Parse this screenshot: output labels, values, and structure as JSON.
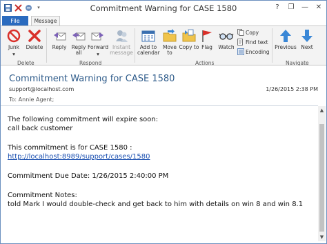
{
  "window": {
    "title": "Commitment Warning for CASE 1580",
    "controls": {
      "help": "?",
      "restore": "❐",
      "minimize": "—",
      "close": "✕"
    }
  },
  "tabs": {
    "file": "File",
    "message": "Message"
  },
  "ribbon": {
    "delete_group": {
      "label": "Delete",
      "junk": "Junk",
      "junk_arrow": "▾",
      "delete": "Delete"
    },
    "respond_group": {
      "label": "Respond",
      "reply": "Reply",
      "reply_all": "Reply all",
      "forward": "Forward",
      "forward_arrow": "▾",
      "instant_message": "Instant message"
    },
    "actions_group": {
      "label": "Actions",
      "add_to_calendar": "Add to calendar",
      "move_to": "Move to",
      "copy_to": "Copy to",
      "flag": "Flag",
      "watch": "Watch",
      "copy": "Copy",
      "find_text": "Find text",
      "encoding": "Encoding"
    },
    "navigate_group": {
      "label": "Navigate",
      "previous": "Previous",
      "next": "Next"
    }
  },
  "message": {
    "subject": "Commitment Warning for CASE 1580",
    "sender": "support@localhost.com",
    "date": "1/26/2015 2:38 PM",
    "to_label": "To:",
    "to_value": "Annie Agent;",
    "body": {
      "line1": "The following commitment will expire soon:",
      "line2": "call back customer",
      "line3": "This commitment is for CASE 1580 :",
      "link": "http://localhost:8989/support/cases/1580",
      "line4": "Commitment Due Date: 1/26/2015 2:40:00 PM",
      "line5": "Commitment Notes:",
      "line6": "told Mark I would double-check and get back to him with details on win 8 and win 8.1"
    }
  },
  "colors": {
    "accent": "#2a6bbf",
    "subject": "#2e5b8a",
    "link": "#1a4fb0",
    "flag_red": "#d9302a",
    "arrow_blue": "#3a87d6"
  },
  "icons": {
    "save": "save-icon",
    "close_small": "close-icon",
    "undo": "undo-icon",
    "junk": "junk-icon",
    "delete": "delete-icon",
    "reply": "reply-icon",
    "reply_all": "reply-all-icon",
    "forward": "forward-icon",
    "instant_message": "instant-message-icon",
    "calendar": "calendar-icon",
    "move": "move-to-folder-icon",
    "copy_to": "copy-to-folder-icon",
    "flag": "flag-icon",
    "watch": "watch-glasses-icon",
    "copy": "copy-icon",
    "find": "find-text-icon",
    "encoding": "encoding-icon",
    "previous": "up-arrow-icon",
    "next": "down-arrow-icon"
  }
}
